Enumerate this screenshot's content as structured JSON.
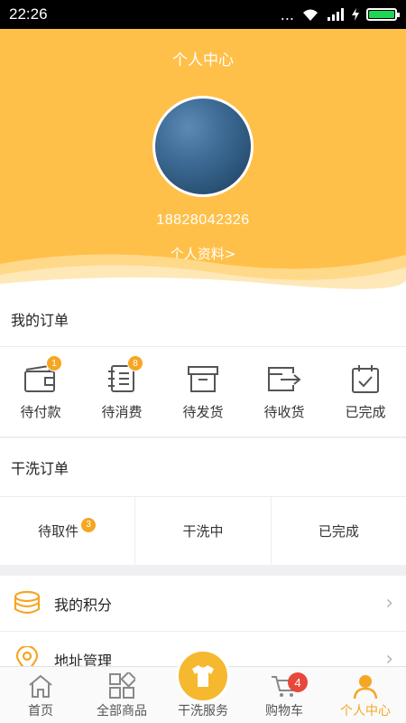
{
  "status": {
    "time": "22:26",
    "dots": "...",
    "battery_percent": 100
  },
  "header": {
    "title": "个人中心",
    "phone": "18828042326",
    "profile_link": "个人资料>"
  },
  "orders": {
    "title": "我的订单",
    "items": [
      {
        "label": "待付款",
        "badge": "1",
        "icon": "wallet-icon"
      },
      {
        "label": "待消费",
        "badge": "8",
        "icon": "notebook-icon"
      },
      {
        "label": "待发货",
        "badge": "",
        "icon": "box-icon"
      },
      {
        "label": "待收货",
        "badge": "",
        "icon": "truck-icon"
      },
      {
        "label": "已完成",
        "badge": "",
        "icon": "calendar-check-icon"
      }
    ]
  },
  "dry_clean": {
    "title": "干洗订单",
    "items": [
      {
        "label": "待取件",
        "badge": "3"
      },
      {
        "label": "干洗中",
        "badge": ""
      },
      {
        "label": "已完成",
        "badge": ""
      }
    ]
  },
  "menu": [
    {
      "label": "我的积分",
      "icon": "coins-icon"
    },
    {
      "label": "地址管理",
      "icon": "location-icon"
    }
  ],
  "tabbar": {
    "items": [
      {
        "label": "首页",
        "icon": "home-icon"
      },
      {
        "label": "全部商品",
        "icon": "grid-icon"
      },
      {
        "label": "干洗服务",
        "icon": "shirt-icon"
      },
      {
        "label": "购物车",
        "icon": "cart-icon",
        "badge": "4"
      },
      {
        "label": "个人中心",
        "icon": "person-icon",
        "active": true
      }
    ]
  },
  "colors": {
    "accent": "#ffc04a",
    "accent_dark": "#f5a623",
    "badge_red": "#e8473b"
  }
}
